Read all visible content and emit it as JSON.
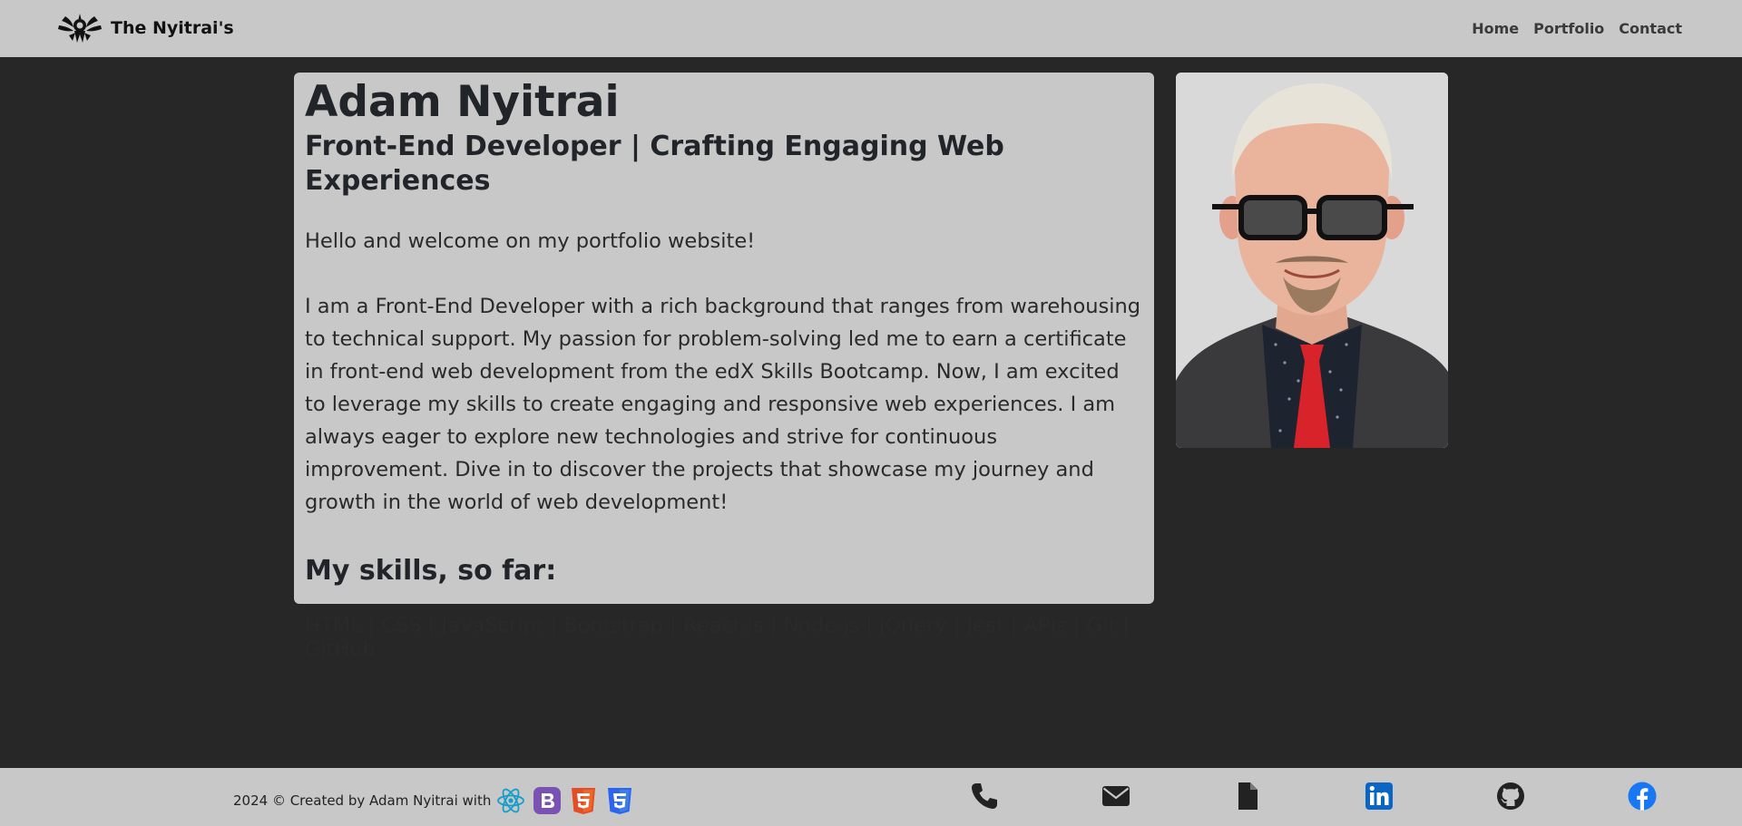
{
  "nav": {
    "brand": "The Nyitrai's",
    "links": [
      "Home",
      "Portfolio",
      "Contact"
    ]
  },
  "profile": {
    "name": "Adam Nyitrai",
    "subtitle": "Front-End Developer | Crafting Engaging Web Experiences",
    "greeting": "Hello and welcome on my portfolio website!",
    "bio": "I am a Front-End Developer with a rich background that ranges from warehousing to technical support. My passion for problem-solving led me to earn a certificate in front-end web development from the edX Skills Bootcamp. Now, I am excited to leverage my skills to create engaging and responsive web experiences. I am always eager to explore new technologies and strive for continuous improvement. Dive in to discover the projects that showcase my journey and growth in the world of web development!",
    "skills_title": "My skills, so far:",
    "skills": "HTML | CSS | JavaScript | Bootstrap | React.js | Node.js | jQuery | Jest | APIs | Git | GitHub"
  },
  "footer": {
    "credit": "2024 © Created by Adam Nyitrai with",
    "tech_icons": [
      "react-icon",
      "bootstrap-icon",
      "html5-icon",
      "css3-icon"
    ],
    "contact_icons": [
      "phone-icon",
      "envelope-icon",
      "document-icon",
      "linkedin-icon",
      "github-icon",
      "facebook-icon"
    ]
  },
  "colors": {
    "background": "#272727",
    "surface": "#c8c8c8",
    "text": "#212529",
    "react": "#149eca",
    "bootstrap": "#7952b3",
    "html5": "#e44d26",
    "css3": "#2965f1",
    "linkedin": "#0a66c2",
    "facebook": "#1877f2"
  }
}
